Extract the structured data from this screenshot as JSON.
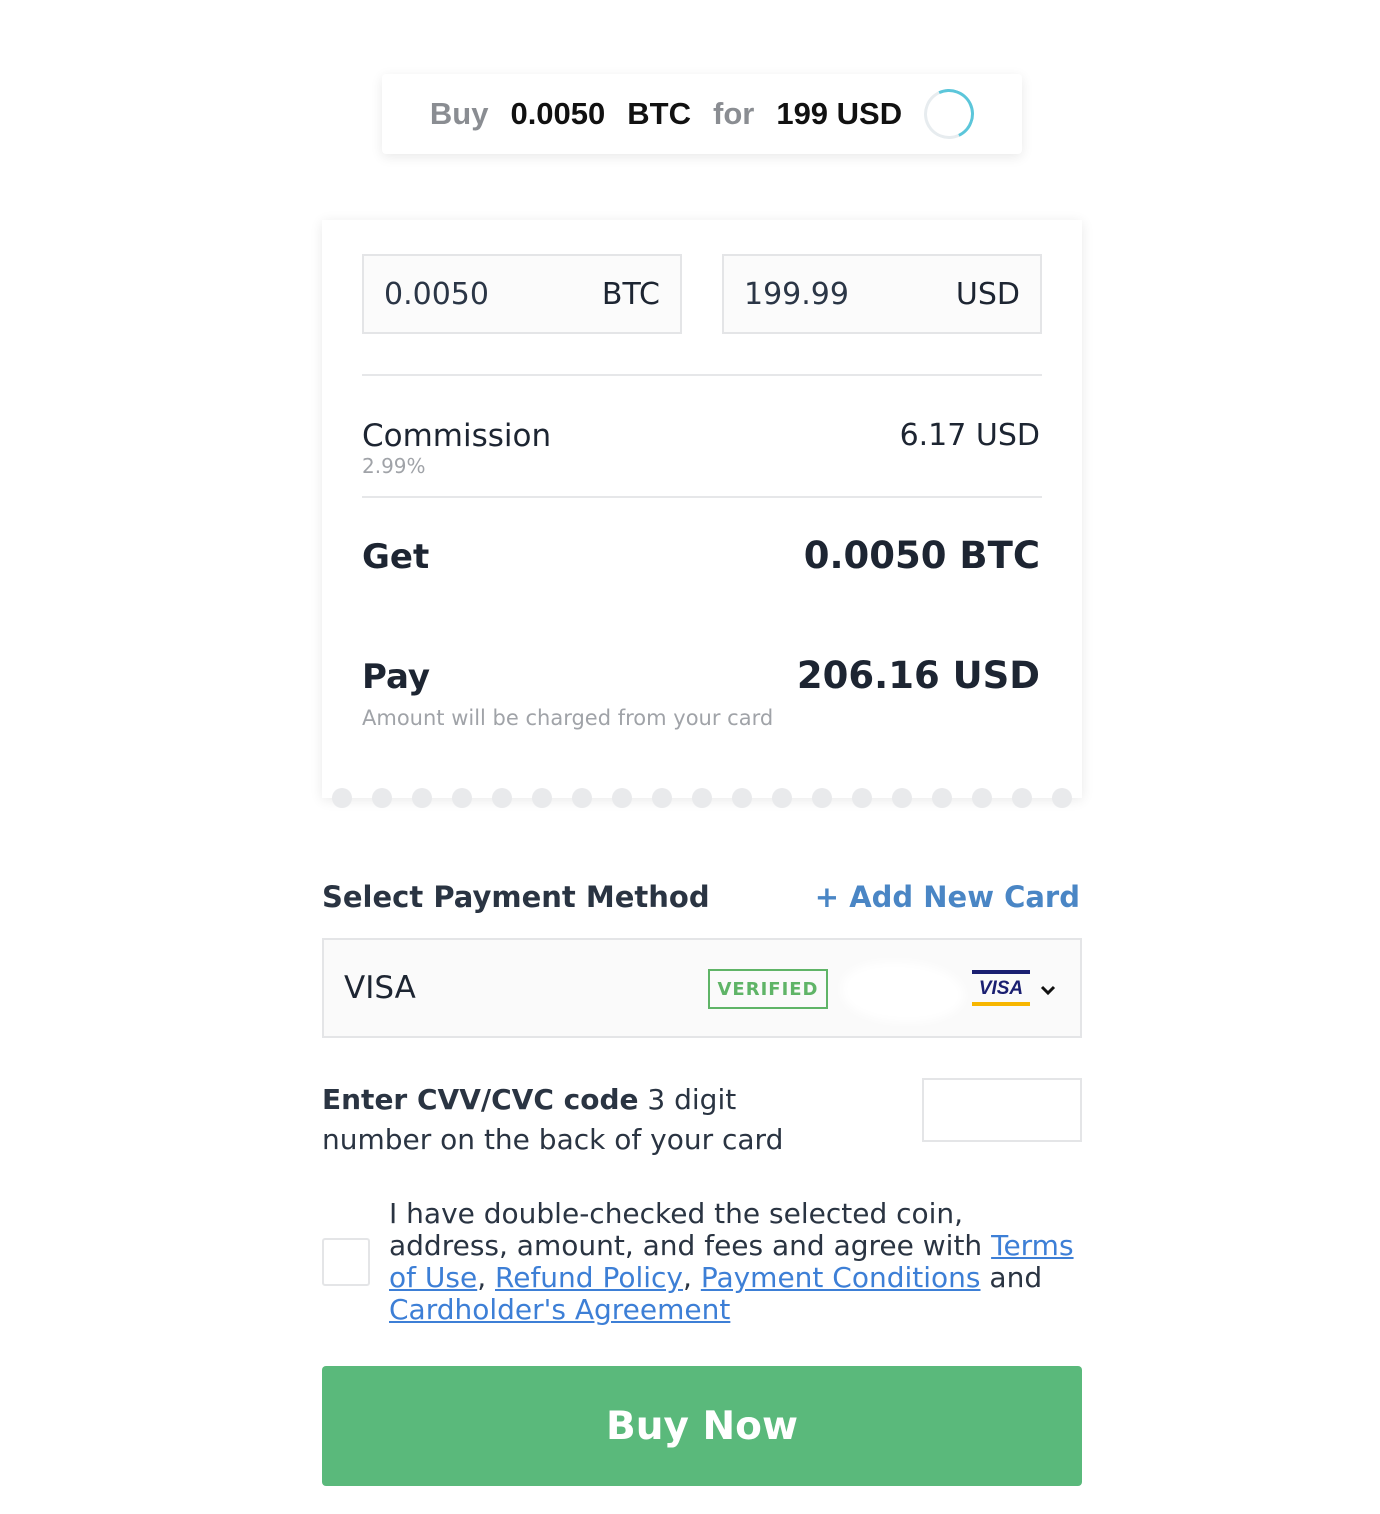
{
  "summary": {
    "buy_word": "Buy",
    "crypto_amount": "0.0050",
    "crypto_code": "BTC",
    "for_word": "for",
    "fiat_amount": "199 USD"
  },
  "receipt": {
    "crypto_input": {
      "value": "0.0050",
      "unit": "BTC"
    },
    "fiat_input": {
      "value": "199.99",
      "unit": "USD"
    },
    "commission": {
      "label": "Commission",
      "rate": "2.99%",
      "value": "6.17 USD"
    },
    "get": {
      "label": "Get",
      "value": "0.0050 BTC"
    },
    "pay": {
      "label": "Pay",
      "note": "Amount will be charged from your card",
      "value": "206.16 USD"
    }
  },
  "payment": {
    "title": "Select Payment Method",
    "add_card": "+ Add New Card",
    "selected_card": {
      "name": "VISA",
      "status": "VERIFIED",
      "brand_logo": "VISA"
    }
  },
  "cvv": {
    "bold": "Enter CVV/CVC code",
    "hint": " 3 digit number on the back of your card",
    "value": ""
  },
  "agreement": {
    "text_before": "I have double-checked the selected coin, address, amount, and fees and agree with ",
    "link_terms": "Terms of Use",
    "sep1": ", ",
    "link_refund": "Refund Policy",
    "sep2": ", ",
    "link_payment": "Payment Conditions",
    "and_word": " and ",
    "link_cardholder": "Cardholder's Agreement",
    "checked": false
  },
  "buy_button": "Buy Now",
  "colors": {
    "accent_green": "#5ab97b",
    "link_blue": "#3d7fd6",
    "verified_green": "#5fb467",
    "spinner": "#5cc6da"
  }
}
